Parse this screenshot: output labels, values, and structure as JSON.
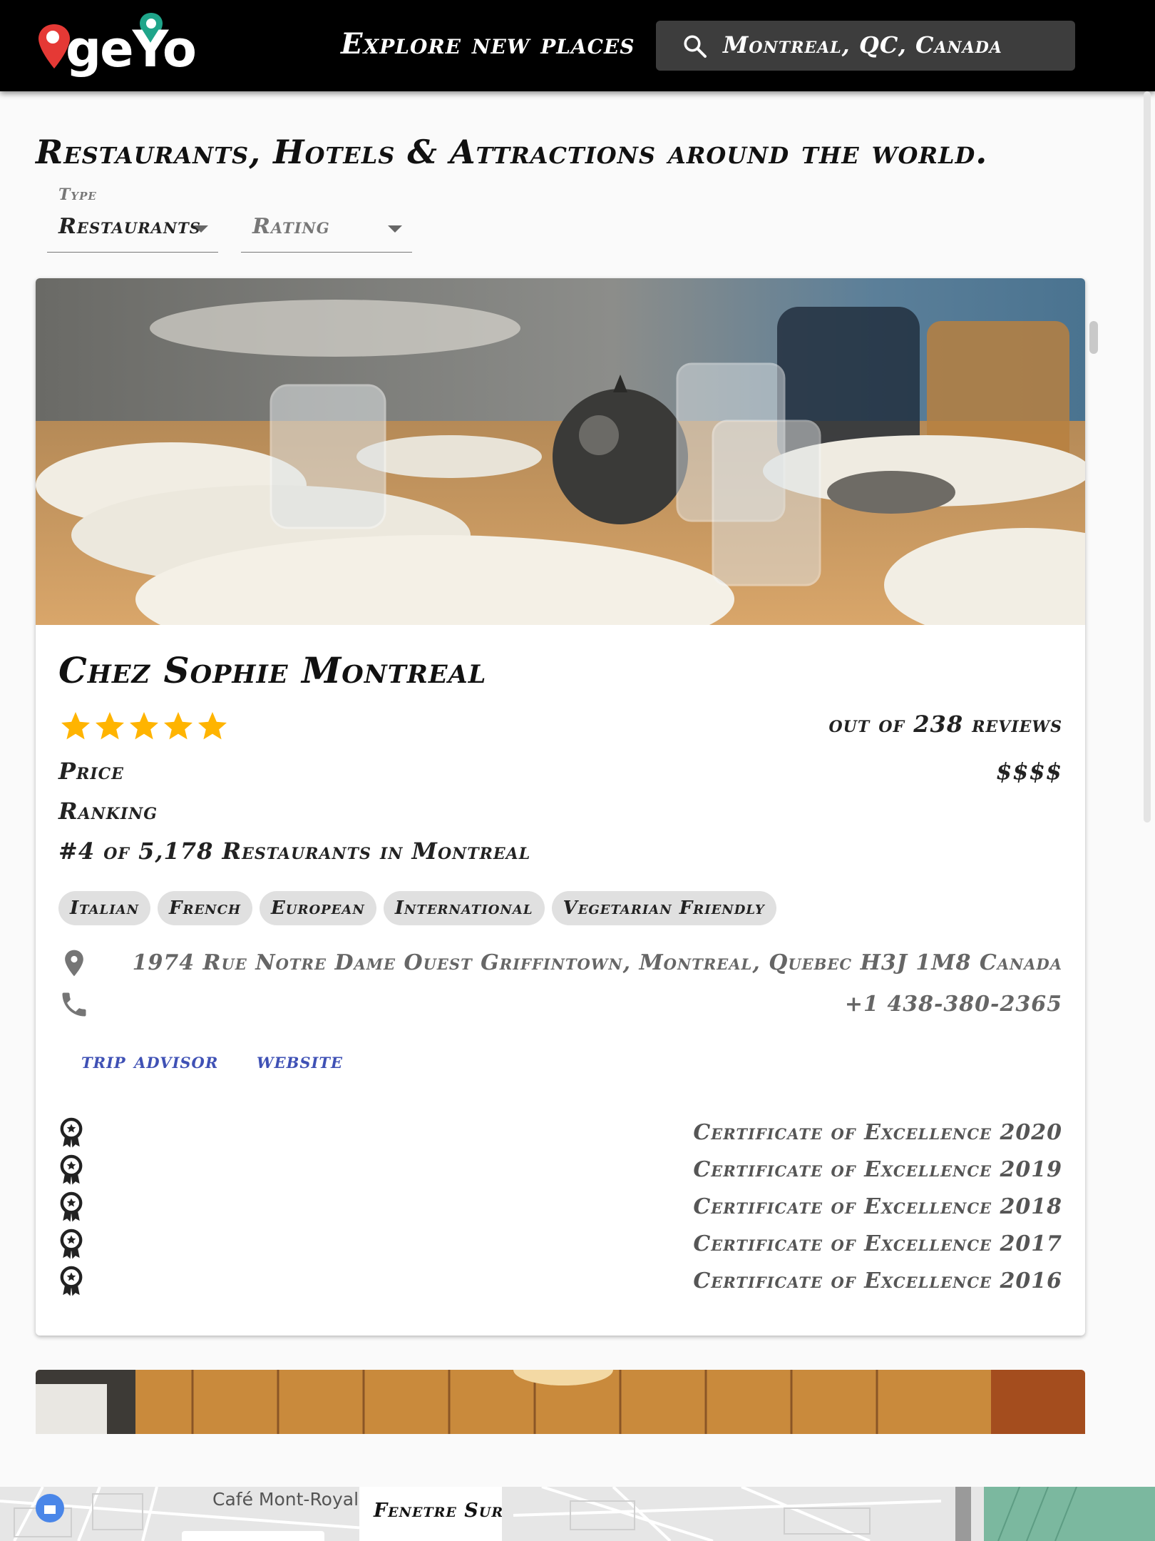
{
  "header": {
    "logo_text": "geYo",
    "tagline": "Explore new places",
    "search_value": "Montreal, QC, Canada",
    "icon": "search-icon"
  },
  "page": {
    "heading": "Restaurants, Hotels & Attractions around the world."
  },
  "filters": {
    "type": {
      "label": "Type",
      "value": "Restaurants"
    },
    "rating": {
      "placeholder": "Rating"
    }
  },
  "card": {
    "name": "Chez Sophie Montreal",
    "rating_stars": 5,
    "reviews_text": "out of 238 reviews",
    "price_label": "Price",
    "price_value": "$$$$",
    "ranking_label": "Ranking",
    "ranking_value": "#4 of 5,178 Restaurants in Montreal",
    "cuisines": [
      "Italian",
      "French",
      "European",
      "International",
      "Vegetarian Friendly"
    ],
    "address": "1974 Rue Notre Dame Ouest Griffintown, Montreal, Quebec H3J 1M8 Canada",
    "phone": "+1 438-380-2365",
    "links": {
      "tripadvisor": "trip advisor",
      "website": "website"
    },
    "awards": [
      "Certificate of Excellence 2020",
      "Certificate of Excellence 2019",
      "Certificate of Excellence 2018",
      "Certificate of Excellence 2017",
      "Certificate of Excellence 2016"
    ]
  },
  "map": {
    "place_label": "Café Mont-Royal",
    "popup_title": "Fenetre Sur"
  },
  "colors": {
    "appbar": "#000000",
    "star": "#ffb400",
    "link": "#3f51b5",
    "pin_red": "#e53935",
    "pin_green": "#1fa58a"
  }
}
